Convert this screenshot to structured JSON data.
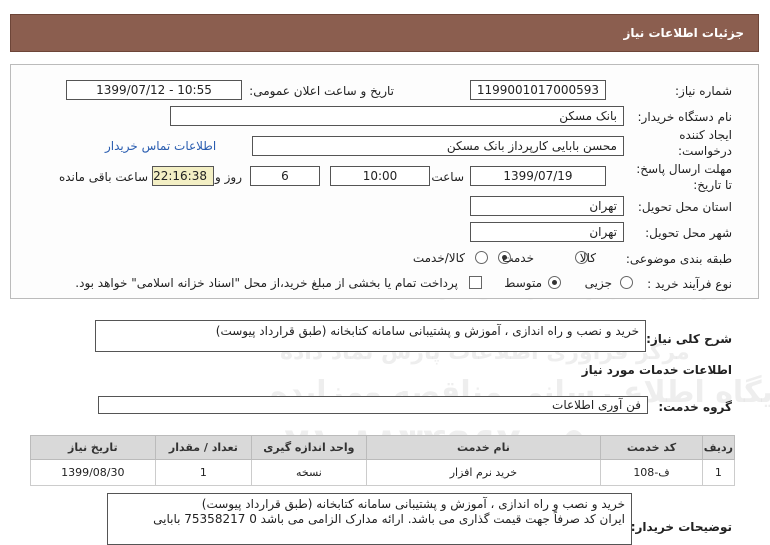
{
  "header": {
    "title": "جزئیات اطلاعات نیاز"
  },
  "form": {
    "need_number_label": "شماره نیاز:",
    "need_number": "1199001017000593",
    "announce_label": "تاریخ و ساعت اعلان عمومی:",
    "announce_value": "1399/07/12 - 10:55",
    "buyer_org_label": "نام دستگاه خریدار:",
    "buyer_org": "بانک مسکن",
    "creator_label_1": "ایجاد کننده",
    "creator_label_2": "درخواست:",
    "creator": "محسن بابایی کارپرداز بانک مسکن",
    "contact_link": "اطلاعات تماس خریدار",
    "deadline_label_1": "مهلت ارسال پاسخ:",
    "deadline_label_2": "تا تاریخ:",
    "deadline_date": "1399/07/19",
    "time_label": "ساعت",
    "deadline_time": "10:00",
    "days_value": "6",
    "days_label": "روز و",
    "remaining_time": "22:16:38",
    "remaining_label": "ساعت باقی مانده",
    "province_label": "استان محل تحویل:",
    "province": "تهران",
    "city_label": "شهر محل تحویل:",
    "city": "تهران",
    "category_label": "طبقه بندی موضوعی:",
    "category_options": [
      "کالا",
      "خدمت",
      "کالا/خدمت"
    ],
    "category_selected": "خدمت",
    "process_label": "نوع فرآیند خرید :",
    "process_options": [
      "جزیی",
      "متوسط"
    ],
    "process_selected": "متوسط",
    "payment_note": "پرداخت تمام یا بخشی از مبلغ خرید،از محل \"اسناد خزانه اسلامی\" خواهد بود."
  },
  "summary": {
    "label": "شرح کلی نیاز:",
    "text": "خرید و نصب و راه اندازی ، آموزش و پشتیبانی سامانه کتابخانه (طبق قرارداد پیوست)"
  },
  "services": {
    "section_title": "اطلاعات خدمات مورد نیاز",
    "group_label": "گروه خدمت:",
    "group_value": "فن آوری اطلاعات",
    "columns": [
      "ردیف",
      "کد خدمت",
      "نام خدمت",
      "واحد اندازه گیری",
      "تعداد / مقدار",
      "تاریخ نیاز"
    ],
    "rows": [
      [
        "1",
        "ف-108",
        "خرید نرم افزار",
        "نسخه",
        "1",
        "1399/08/30"
      ]
    ]
  },
  "buyer_notes": {
    "label": "توضیحات خریدار:",
    "line1": "خرید و نصب و راه اندازی ، آموزش و پشتیبانی سامانه کتابخانه (طبق قرارداد پیوست)",
    "line2": "ایران کد صرفاً جهت قیمت گذاری می باشد. ارائه مدارک الزامی می باشد 0 75358217 بابایی"
  },
  "watermark": {
    "line1": "ParsNamadData",
    "line2": "مرکز فراوری اطلاعات پارس نماد داده",
    "line3": "پایگاه اطلاع رسانی مناقصه ومزایده",
    "line4": "۰۲۱-۸۸۳۴۹۶۷۰-۵"
  },
  "colors": {
    "header_bg": "#8b5e4f",
    "remaining_bg": "#f3efc4",
    "link": "#2a5db0"
  }
}
